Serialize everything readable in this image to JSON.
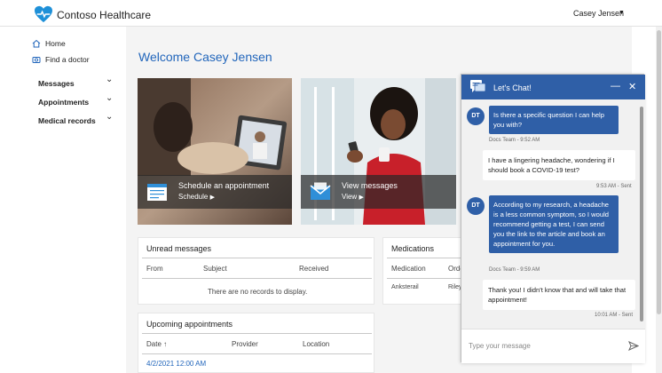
{
  "header": {
    "brand": "Contoso Healthcare",
    "user_name": "Casey Jensen",
    "user_caret": "▼",
    "logo_color": "#1e90d8"
  },
  "sidebar": {
    "links": [
      {
        "label": "Home",
        "icon": "home-icon"
      },
      {
        "label": "Find a doctor",
        "icon": "camera-icon"
      }
    ],
    "groups": [
      {
        "label": "Messages"
      },
      {
        "label": "Appointments"
      },
      {
        "label": "Medical records"
      }
    ],
    "chevron": "⌄"
  },
  "main": {
    "welcome": "Welcome Casey Jensen",
    "tiles": [
      {
        "title": "Schedule an appointment",
        "link": "Schedule",
        "arrow": "▶",
        "icon": "calendar-icon"
      },
      {
        "title": "View messages",
        "link": "View",
        "arrow": "▶",
        "icon": "envelope-icon"
      }
    ],
    "unread": {
      "title": "Unread messages",
      "columns": [
        "From",
        "Subject",
        "Received"
      ],
      "empty": "There are no records to display."
    },
    "medications": {
      "title": "Medications",
      "columns": [
        "Medication",
        "Orde"
      ],
      "rows": [
        [
          "Anksterail",
          "Riley"
        ]
      ]
    },
    "appointments": {
      "title": "Upcoming appointments",
      "columns": [
        "Date",
        "Provider",
        "Location"
      ],
      "sort_icon": "↑",
      "rows": [
        [
          "4/2/2021 12:00 AM"
        ]
      ]
    }
  },
  "chat": {
    "title": "Let's Chat!",
    "minimize": "—",
    "close": "✕",
    "messages": [
      {
        "from": "bot",
        "avatar": "DT",
        "text": "Is there a specific question I can help you with?",
        "meta": "Docs Team - 9:52 AM"
      },
      {
        "from": "user",
        "text": "I have a lingering headache, wondering if I should book a COVID-19 test?",
        "meta": "9:53 AM - Sent"
      },
      {
        "from": "bot",
        "avatar": "DT",
        "text": "According to my research, a headache is a less common symptom, so I would recommend getting a test, I can send you the link to the article and book an appointment for you.",
        "meta": "Docs Team - 9:59 AM"
      },
      {
        "from": "user",
        "text": "Thank you! I didn't know that and will take that appointment!",
        "meta": "10:01 AM - Sent"
      }
    ],
    "input_placeholder": "Type your message",
    "accent": "#2f5fa7"
  }
}
